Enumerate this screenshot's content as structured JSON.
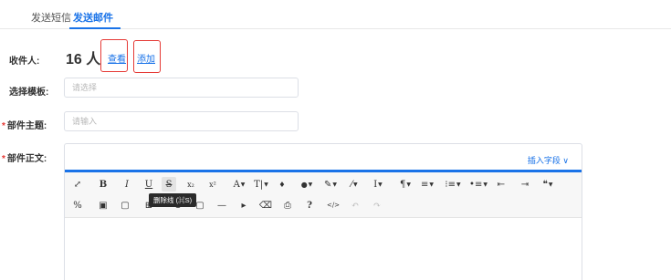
{
  "tabs": [
    {
      "label": "发送短信"
    },
    {
      "label": "发送邮件"
    }
  ],
  "form": {
    "recipients": {
      "label": "收件人:",
      "count": "16 人",
      "view_link": "查看",
      "add_link": "添加"
    },
    "template": {
      "label": "选择模板:",
      "placeholder": "请选择"
    },
    "subject": {
      "required_mark": "*",
      "label": "部件主题:",
      "placeholder": "请输入"
    },
    "body": {
      "required_mark": "*",
      "label": "部件正文:",
      "insert_field": "插入字段 ∨"
    }
  },
  "toolbar": {
    "row1": [
      "⤢",
      "B",
      "I",
      "U",
      "S",
      "x₂",
      "x²",
      "A",
      "T|",
      "♦",
      "●",
      "✎",
      "⁄",
      "I",
      "¶",
      "≡",
      "⁝≡",
      "•≡",
      "⇤",
      "⇥",
      "❝"
    ],
    "row2": [
      "%",
      "▣",
      "▢",
      "⊞",
      "☺",
      "▢",
      "—",
      "▸",
      "⌫",
      "⎙",
      "?",
      "</>",
      "↶",
      "↷"
    ],
    "tooltip": "删除线 (⌘S)"
  },
  "colors": {
    "accent": "#1a73e8",
    "highlight_box": "#e53935"
  }
}
